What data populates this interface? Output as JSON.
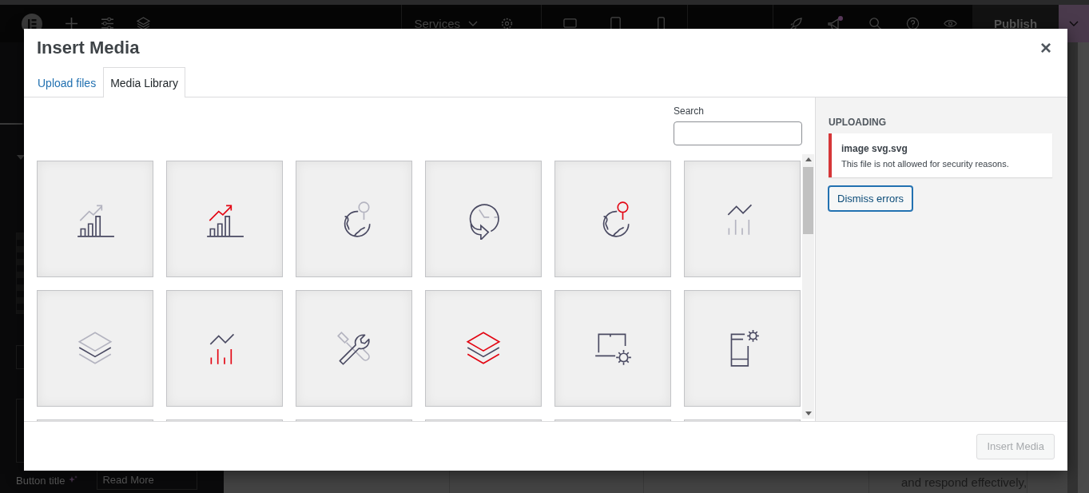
{
  "editor_bar": {
    "page_title": "Services",
    "publish_label": "Publish"
  },
  "left_panel": {
    "button_title_label": "Button title",
    "button_title_value": "Read More"
  },
  "canvas": {
    "text": "and respond effectively,"
  },
  "dialog": {
    "title": "Insert Media",
    "close": "×",
    "tabs": [
      {
        "label": "Upload files",
        "selected": false
      },
      {
        "label": "Media Library",
        "selected": true
      }
    ],
    "search": {
      "label": "Search"
    },
    "media": [
      {
        "kind": "chart",
        "color": "#b4b4c0"
      },
      {
        "kind": "chart",
        "color": "#e30613"
      },
      {
        "kind": "globe",
        "color": "#b4b4c0"
      },
      {
        "kind": "clock",
        "color": "#b4b4c0"
      },
      {
        "kind": "globe",
        "color": "#e30613"
      },
      {
        "kind": "signal",
        "color": "#b4b4c0"
      },
      {
        "kind": "layers",
        "color": "#b4b4c0"
      },
      {
        "kind": "signal",
        "color": "#e30613"
      },
      {
        "kind": "tools",
        "color": "#b4b4c0"
      },
      {
        "kind": "layers",
        "color": "#e30613"
      },
      {
        "kind": "laptop",
        "color": "#4a4a62"
      },
      {
        "kind": "phone",
        "color": "#4a4a62"
      },
      {
        "kind": "partial"
      },
      {
        "kind": "partial"
      },
      {
        "kind": "partial"
      },
      {
        "kind": "partial"
      },
      {
        "kind": "partial"
      },
      {
        "kind": "partial"
      }
    ],
    "uploading": {
      "heading": "UPLOADING",
      "errors": [
        {
          "file": "image svg.svg",
          "message": "This file is not allowed for security reasons."
        }
      ],
      "dismiss_label": "Dismiss errors"
    },
    "insert_button": {
      "label": "Insert Media",
      "disabled": true
    }
  }
}
